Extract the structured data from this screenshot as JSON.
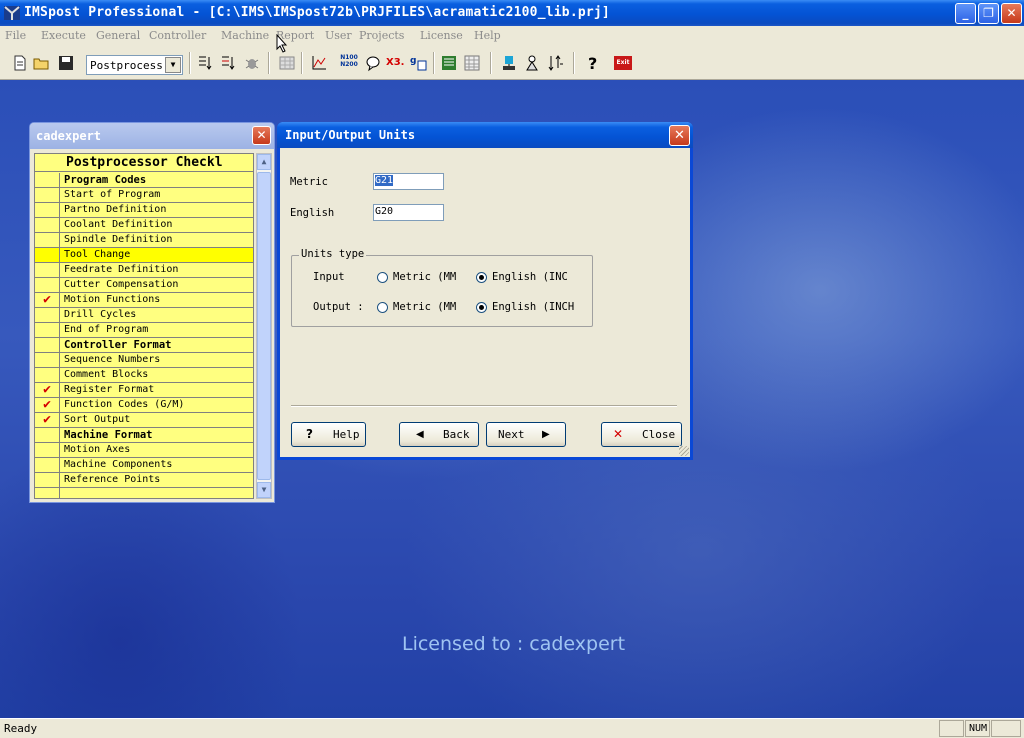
{
  "window": {
    "title": "IMSpost Professional - [C:\\IMS\\IMSpost72b\\PRJFILES\\acramatic2100_lib.prj]",
    "minimize_label": "_",
    "maximize_label": "❐",
    "close_label": "✕"
  },
  "menu": [
    "File",
    "Execute",
    "General",
    "Controller",
    "Machine",
    "Report",
    "User",
    "Projects",
    "License",
    "Help"
  ],
  "toolbar": {
    "mode_select_value": "Postprocess",
    "n100_label_top": "N100",
    "n100_label_bottom": "N200",
    "x3_label": "X3.",
    "exit_label": "Exit"
  },
  "checklist_panel": {
    "title": "cadexpert",
    "close_label": "✕",
    "header": "Postprocessor Checkl",
    "check_mark": "✔",
    "rows": [
      {
        "label": "Program Codes",
        "section": true,
        "checked": false
      },
      {
        "label": "Start of Program",
        "section": false,
        "checked": false
      },
      {
        "label": "Partno Definition",
        "section": false,
        "checked": false
      },
      {
        "label": "Coolant Definition",
        "section": false,
        "checked": false
      },
      {
        "label": "Spindle Definition",
        "section": false,
        "checked": false
      },
      {
        "label": "Tool Change",
        "section": false,
        "checked": false,
        "selected": true
      },
      {
        "label": "Feedrate Definition",
        "section": false,
        "checked": false
      },
      {
        "label": "Cutter Compensation",
        "section": false,
        "checked": false
      },
      {
        "label": "Motion Functions",
        "section": false,
        "checked": true
      },
      {
        "label": "Drill Cycles",
        "section": false,
        "checked": false
      },
      {
        "label": "End of Program",
        "section": false,
        "checked": false
      },
      {
        "label": "Controller Format",
        "section": true,
        "checked": false
      },
      {
        "label": "Sequence Numbers",
        "section": false,
        "checked": false
      },
      {
        "label": "Comment Blocks",
        "section": false,
        "checked": false
      },
      {
        "label": "Register Format",
        "section": false,
        "checked": true
      },
      {
        "label": "Function Codes (G/M)",
        "section": false,
        "checked": true
      },
      {
        "label": "Sort Output",
        "section": false,
        "checked": true
      },
      {
        "label": "Machine Format",
        "section": true,
        "checked": false
      },
      {
        "label": "Motion Axes",
        "section": false,
        "checked": false
      },
      {
        "label": "Machine Components",
        "section": false,
        "checked": false
      },
      {
        "label": "Reference Points",
        "section": false,
        "checked": false
      }
    ]
  },
  "dialog": {
    "title": "Input/Output Units",
    "close_label": "✕",
    "metric_label": "Metric",
    "metric_value": "G21",
    "english_label": "English",
    "english_value": "G20",
    "units_type_title": "Units type",
    "input_label": "Input",
    "output_label": "Output :",
    "input_metric_option": "Metric (MM",
    "input_english_option": "English (INC",
    "output_metric_option": "Metric (MM",
    "output_english_option": "English (INCH",
    "input_selection": "English",
    "output_selection": "English",
    "help_label": "Help",
    "back_label": "Back",
    "next_label": "Next",
    "close_button_label": "Close"
  },
  "desktop": {
    "license_text": "Licensed to : cadexpert"
  },
  "statusbar": {
    "text": "Ready",
    "num_indicator": "NUM"
  }
}
